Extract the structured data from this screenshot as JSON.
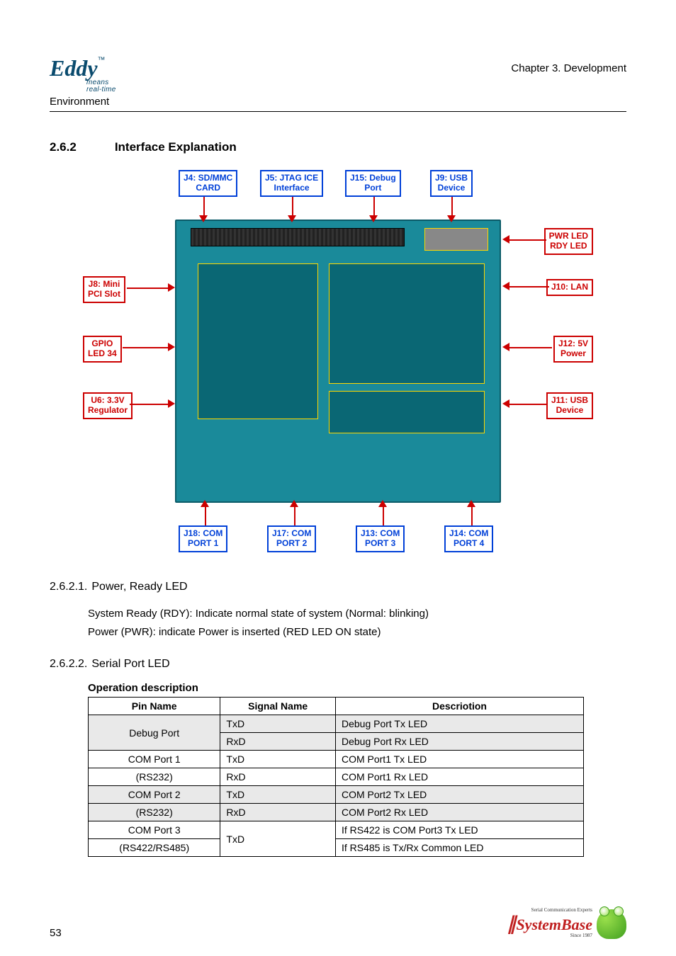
{
  "header": {
    "logo_main": "Eddy",
    "logo_tm": "™",
    "logo_sub": "means\nreal-time",
    "environment": "Environment",
    "chapter": "Chapter 3. Development"
  },
  "section": {
    "num": "2.6.2",
    "title": "Interface Explanation"
  },
  "diagram": {
    "top": [
      {
        "text": "J4: SD/MMC\nCARD"
      },
      {
        "text": "J5: JTAG ICE\nInterface"
      },
      {
        "text": "J15: Debug\nPort"
      },
      {
        "text": "J9: USB\nDevice"
      }
    ],
    "bottom": [
      {
        "text": "J18: COM\nPORT 1"
      },
      {
        "text": "J17: COM\nPORT 2"
      },
      {
        "text": "J13: COM\nPORT 3"
      },
      {
        "text": "J14: COM\nPORT 4"
      }
    ],
    "left": [
      {
        "text": "J8: Mini\nPCI Slot"
      },
      {
        "text": "GPIO\nLED 34"
      },
      {
        "text": "U6: 3.3V\nRegulator"
      }
    ],
    "right": [
      {
        "text": "PWR LED\nRDY LED"
      },
      {
        "text": "J10: LAN"
      },
      {
        "text": "J12: 5V\nPower"
      },
      {
        "text": "J11: USB\nDevice"
      }
    ]
  },
  "sub1": {
    "num": "2.6.2.1.",
    "title": "Power, Ready LED",
    "lines": [
      "System Ready (RDY): Indicate normal state of system (Normal: blinking)",
      "Power (PWR): indicate Power is inserted (RED LED ON state)"
    ]
  },
  "sub2": {
    "num": "2.6.2.2.",
    "title": "Serial Port LED",
    "op": "Operation description"
  },
  "table": {
    "h_pin": "Pin Name",
    "h_sig": "Signal Name",
    "h_desc": "Descriotion",
    "rows": [
      {
        "pin": "Debug Port",
        "sig": "TxD",
        "desc": "Debug Port Tx LED",
        "g": true
      },
      {
        "pin": "",
        "sig": "RxD",
        "desc": "Debug Port Rx LED",
        "g": true
      },
      {
        "pin": "COM Port 1",
        "sig": "TxD",
        "desc": "COM Port1 Tx LED",
        "g": false
      },
      {
        "pin": "(RS232)",
        "sig": "RxD",
        "desc": "COM Port1 Rx LED",
        "g": false
      },
      {
        "pin": "COM Port 2",
        "sig": "TxD",
        "desc": "COM Port2 Tx LED",
        "g": true
      },
      {
        "pin": "(RS232)",
        "sig": "RxD",
        "desc": "COM Port2 Rx LED",
        "g": true
      },
      {
        "pin": "COM Port 3",
        "sig": "TxD",
        "desc": "If RS422 is COM Port3 Tx LED",
        "g": false
      },
      {
        "pin": "(RS422/RS485)",
        "sig": "",
        "desc": "If RS485 is Tx/Rx Common LED",
        "g": false
      }
    ]
  },
  "footer": {
    "page": "53",
    "brand": "SystemBase",
    "tag_top": "Serial Communication Experts",
    "tag_bot": "Since 1987"
  }
}
